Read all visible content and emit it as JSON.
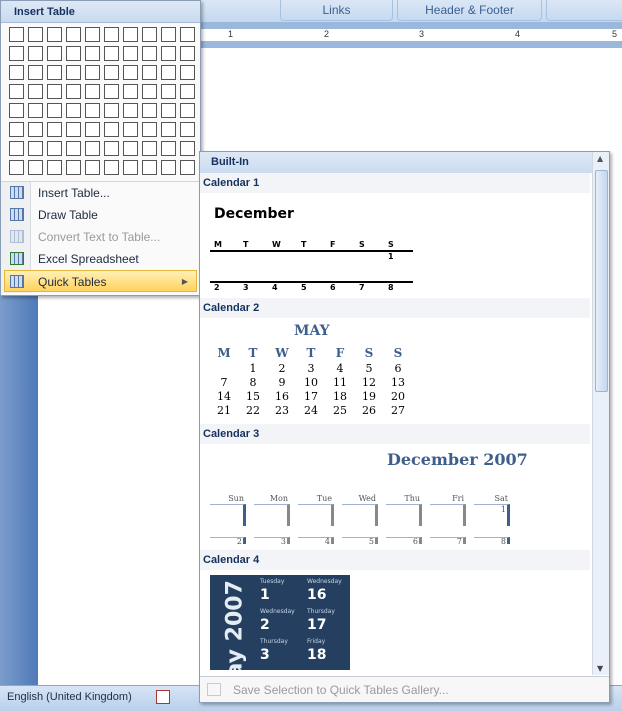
{
  "ribbon": {
    "tabs": [
      "Links",
      "Header & Footer"
    ]
  },
  "ruler": {
    "marks": [
      "1",
      "2",
      "3",
      "4",
      "5"
    ]
  },
  "status": {
    "language": "English (United Kingdom)"
  },
  "insert_menu": {
    "title": "Insert Table",
    "grid_columns": 10,
    "grid_rows": 8,
    "items": [
      {
        "label": "Insert Table...",
        "icon": "table-icon",
        "enabled": true
      },
      {
        "label": "Draw Table",
        "icon": "draw-table-icon",
        "enabled": true
      },
      {
        "label": "Convert Text to Table...",
        "icon": "convert-icon",
        "enabled": false
      },
      {
        "label": "Excel Spreadsheet",
        "icon": "excel-icon",
        "enabled": true
      },
      {
        "label": "Quick Tables",
        "icon": "table-icon",
        "enabled": true,
        "highlighted": true,
        "submenu": true
      }
    ]
  },
  "gallery": {
    "header": "Built-In",
    "calendar1": {
      "label": "Calendar 1",
      "month": "December",
      "days": [
        "M",
        "T",
        "W",
        "T",
        "F",
        "S",
        "S"
      ],
      "row1": [
        "",
        "",
        "",
        "",
        "",
        "",
        "1"
      ],
      "row2": [
        "2",
        "3",
        "4",
        "5",
        "6",
        "7",
        "8"
      ]
    },
    "calendar2": {
      "label": "Calendar 2",
      "month": "MAY",
      "days": [
        "M",
        "T",
        "W",
        "T",
        "F",
        "S",
        "S"
      ],
      "weeks": [
        [
          "",
          "1",
          "2",
          "3",
          "4",
          "5",
          "6"
        ],
        [
          "7",
          "8",
          "9",
          "10",
          "11",
          "12",
          "13"
        ],
        [
          "14",
          "15",
          "16",
          "17",
          "18",
          "19",
          "20"
        ],
        [
          "21",
          "22",
          "23",
          "24",
          "25",
          "26",
          "27"
        ]
      ]
    },
    "calendar3": {
      "label": "Calendar 3",
      "month": "December 2007",
      "days": [
        "Sun",
        "Mon",
        "Tue",
        "Wed",
        "Thu",
        "Fri",
        "Sat"
      ],
      "row1": [
        "",
        "",
        "",
        "",
        "",
        "",
        "1"
      ],
      "row2": [
        "2",
        "3",
        "4",
        "5",
        "6",
        "7",
        "8"
      ]
    },
    "calendar4": {
      "label": "Calendar 4",
      "side": "ay 2007",
      "entries": [
        {
          "day": "Tuesday",
          "num": "1"
        },
        {
          "day": "Wednesday",
          "num": "16"
        },
        {
          "day": "Wednesday",
          "num": "2"
        },
        {
          "day": "Thursday",
          "num": "17"
        },
        {
          "day": "Thursday",
          "num": "3"
        },
        {
          "day": "Friday",
          "num": "18"
        }
      ]
    },
    "footer": "Save Selection to Quick Tables Gallery..."
  }
}
